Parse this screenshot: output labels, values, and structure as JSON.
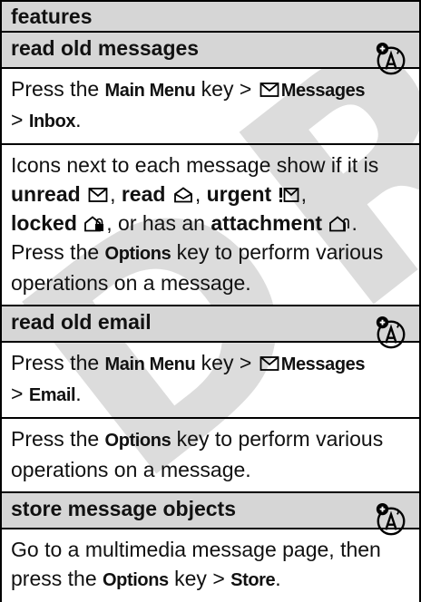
{
  "watermark": "DRAFT",
  "header": {
    "title": "features"
  },
  "sections": [
    {
      "title": "read old messages",
      "icon": "network-feature-icon",
      "p1": {
        "t1": "Press the ",
        "k1": "Main Menu",
        "t2": " key > ",
        "k2": "Messages",
        "t3": "> ",
        "k3": "Inbox",
        "t4": "."
      },
      "p2": {
        "t1": "Icons next to each message show if it is",
        "unread": "unread",
        "read": "read",
        "urgent": "urgent",
        "locked": "locked",
        "t2": ", or has an ",
        "attachment": "attachment",
        "t3": "Press the ",
        "k1": "Options",
        "t4": " key to perform various operations on a message."
      }
    },
    {
      "title": "read old email",
      "icon": "network-feature-icon",
      "p1": {
        "t1": "Press the ",
        "k1": "Main Menu",
        "t2": " key > ",
        "k2": "Messages",
        "t3": "> ",
        "k3": "Email",
        "t4": "."
      },
      "p2": {
        "t1": "Press the ",
        "k1": "Options",
        "t2": " key to perform various operations on a message."
      }
    },
    {
      "title": "store message objects",
      "icon": "network-feature-icon",
      "p1": {
        "t1": "Go to a multimedia message page, then press the ",
        "k1": "Options",
        "t2": " key > ",
        "k2": "Store",
        "t3": "."
      }
    }
  ]
}
